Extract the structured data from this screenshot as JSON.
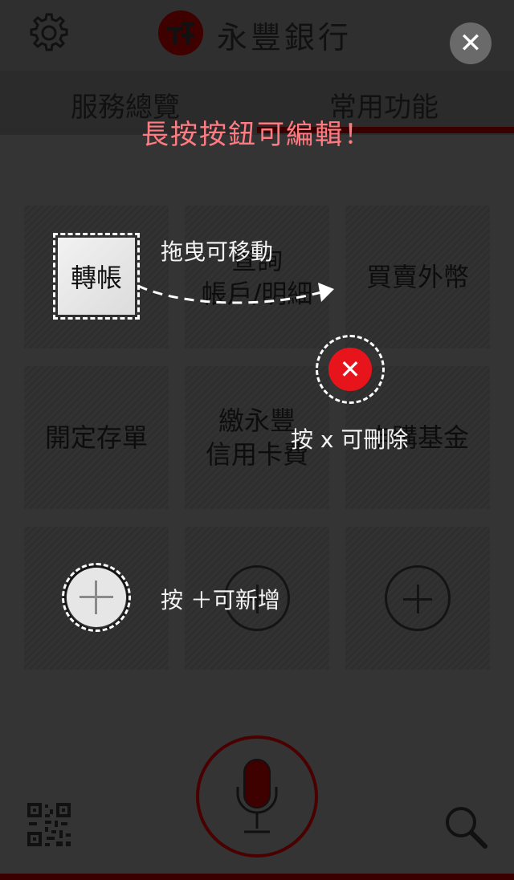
{
  "header": {
    "brand_name": "永豐銀行",
    "icons": {
      "settings": "gear-icon",
      "logo": "sinopac-logo",
      "close": "close-icon"
    },
    "close_symbol": "✕"
  },
  "tabs": [
    {
      "label": "服務總覽",
      "active": false
    },
    {
      "label": "常用功能",
      "active": true
    }
  ],
  "grid": {
    "tiles": [
      {
        "line1": "",
        "line2": "",
        "type": "empty"
      },
      {
        "line1": "查詢",
        "line2": "帳戶/明細",
        "type": "function"
      },
      {
        "line1": "買賣外幣",
        "line2": "",
        "type": "function"
      },
      {
        "line1": "開定存單",
        "line2": "",
        "type": "function"
      },
      {
        "line1": "繳永豐",
        "line2": "信用卡費",
        "type": "function"
      },
      {
        "line1": "申購基金",
        "line2": "",
        "type": "function"
      },
      {
        "type": "add"
      },
      {
        "type": "add"
      },
      {
        "type": "add"
      }
    ]
  },
  "tutorial": {
    "edit_hint": "長按按鈕可編輯！",
    "drag_hint": "拖曳可移動",
    "demo_tile_label": "轉帳",
    "delete_hint": "按 x 可刪除",
    "delete_symbol": "✕",
    "add_hint": "按 ＋可新增"
  },
  "bottom": {
    "icons": {
      "qr": "qr-code-icon",
      "mic": "microphone-icon",
      "search": "search-icon"
    }
  },
  "colors": {
    "background": "#343434",
    "accent_dark_red": "#3a0000",
    "hint_pink": "#ff7b82",
    "delete_red": "#e8141c"
  }
}
